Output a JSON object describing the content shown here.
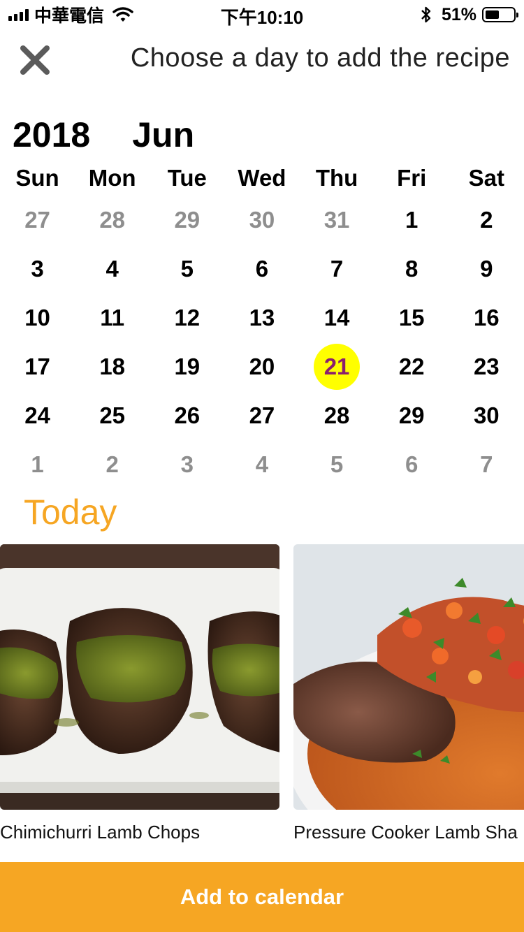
{
  "status_bar": {
    "carrier": "中華電信",
    "time": "下午10:10",
    "battery_percent": "51%",
    "battery_level": 0.51,
    "icons": [
      "signal-icon",
      "wifi-icon",
      "bluetooth-icon",
      "battery-icon"
    ]
  },
  "header": {
    "title": "Choose a day to add the recipe",
    "close_icon": "close-icon"
  },
  "calendar": {
    "year": "2018",
    "month": "Jun",
    "weekdays": [
      "Sun",
      "Mon",
      "Tue",
      "Wed",
      "Thu",
      "Fri",
      "Sat"
    ],
    "days": [
      {
        "label": "27",
        "muted": true
      },
      {
        "label": "28",
        "muted": true
      },
      {
        "label": "29",
        "muted": true
      },
      {
        "label": "30",
        "muted": true
      },
      {
        "label": "31",
        "muted": true
      },
      {
        "label": "1"
      },
      {
        "label": "2"
      },
      {
        "label": "3"
      },
      {
        "label": "4"
      },
      {
        "label": "5"
      },
      {
        "label": "6"
      },
      {
        "label": "7"
      },
      {
        "label": "8"
      },
      {
        "label": "9"
      },
      {
        "label": "10"
      },
      {
        "label": "11"
      },
      {
        "label": "12"
      },
      {
        "label": "13"
      },
      {
        "label": "14"
      },
      {
        "label": "15"
      },
      {
        "label": "16"
      },
      {
        "label": "17"
      },
      {
        "label": "18"
      },
      {
        "label": "19"
      },
      {
        "label": "20"
      },
      {
        "label": "21",
        "selected": true
      },
      {
        "label": "22"
      },
      {
        "label": "23"
      },
      {
        "label": "24"
      },
      {
        "label": "25"
      },
      {
        "label": "26"
      },
      {
        "label": "27"
      },
      {
        "label": "28"
      },
      {
        "label": "29"
      },
      {
        "label": "30"
      },
      {
        "label": "1",
        "muted": true
      },
      {
        "label": "2",
        "muted": true
      },
      {
        "label": "3",
        "muted": true
      },
      {
        "label": "4",
        "muted": true
      },
      {
        "label": "5",
        "muted": true
      },
      {
        "label": "6",
        "muted": true
      },
      {
        "label": "7",
        "muted": true
      }
    ]
  },
  "today": {
    "label": "Today",
    "recipes": [
      {
        "title": "Chimichurri Lamb Chops"
      },
      {
        "title": "Pressure Cooker Lamb Sha"
      }
    ]
  },
  "cta": {
    "label": "Add to calendar"
  },
  "colors": {
    "accent": "#f6a623",
    "selected_bg": "#ffff00",
    "selected_text": "#8a1f6e",
    "muted_text": "#8e8e8e"
  }
}
